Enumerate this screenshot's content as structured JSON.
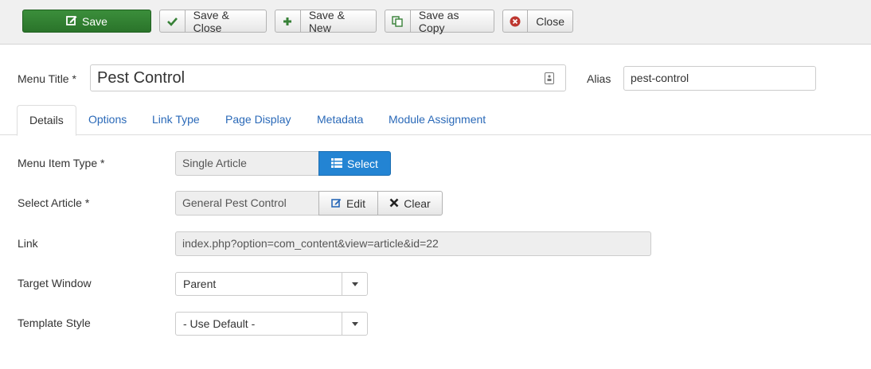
{
  "toolbar": {
    "save_label": "Save",
    "save_close_label": "Save & Close",
    "save_new_label": "Save & New",
    "save_copy_label": "Save as Copy",
    "close_label": "Close"
  },
  "form": {
    "title_label": "Menu Title *",
    "title_value": "Pest Control",
    "alias_label": "Alias",
    "alias_value": "pest-control"
  },
  "tabs": [
    {
      "label": "Details",
      "active": true
    },
    {
      "label": "Options"
    },
    {
      "label": "Link Type"
    },
    {
      "label": "Page Display"
    },
    {
      "label": "Metadata"
    },
    {
      "label": "Module Assignment"
    }
  ],
  "details": {
    "menu_item_type_label": "Menu Item Type *",
    "menu_item_type_value": "Single Article",
    "select_button_label": "Select",
    "select_article_label": "Select Article *",
    "select_article_value": "General Pest Control",
    "edit_button_label": "Edit",
    "clear_button_label": "Clear",
    "link_label": "Link",
    "link_value": "index.php?option=com_content&view=article&id=22",
    "target_window_label": "Target Window",
    "target_window_value": "Parent",
    "template_style_label": "Template Style",
    "template_style_value": "- Use Default -"
  },
  "colors": {
    "save_green": "#2f7d32",
    "select_blue": "#2384d3",
    "tab_link_blue": "#2a69b8",
    "close_icon_red": "#bd362f"
  },
  "icons": [
    "pencil-square-icon",
    "checkmark-icon",
    "plus-icon",
    "copy-icon",
    "close-circle-icon",
    "list-icon",
    "edit-icon",
    "x-icon",
    "id-card-icon",
    "caret-down-icon"
  ]
}
